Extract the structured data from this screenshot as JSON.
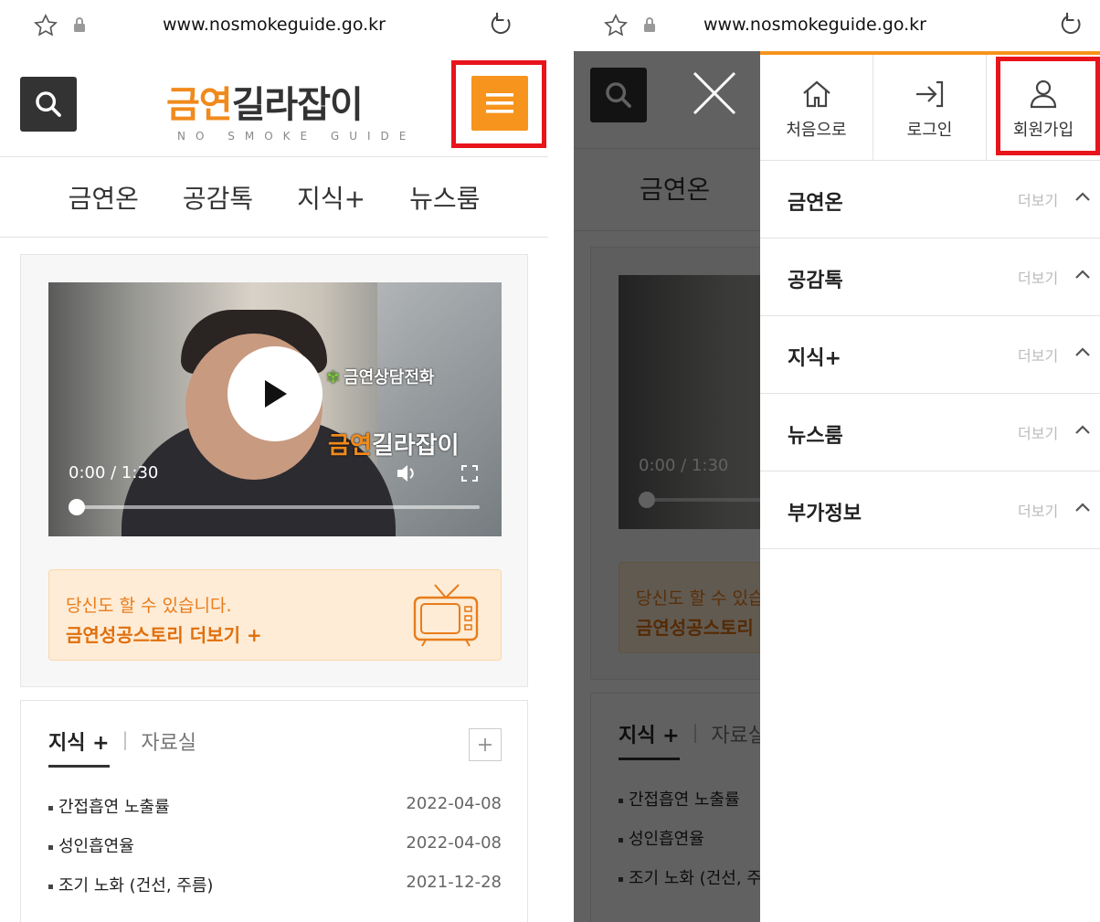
{
  "browser": {
    "url": "www.nosmokeguide.go.kr"
  },
  "logo": {
    "main_orange": "금연",
    "main_dark": "길라잡이",
    "sub": "NO SMOKE GUIDE"
  },
  "nav": [
    "금연온",
    "공감톡",
    "지식+",
    "뉴스룸"
  ],
  "video": {
    "brand_hotline": "금연상담전화",
    "brand_logo_orange": "금연",
    "brand_logo_dark": "길라잡이",
    "time": "0:00 / 1:30",
    "progress": 0.0
  },
  "story": {
    "line1": "당신도 할 수 있습니다.",
    "line2": "금연성공스토리 더보기 +"
  },
  "list": {
    "tab_active": "지식 +",
    "tab_sep": "|",
    "tab_inactive": "자료실",
    "items": [
      {
        "title": "간접흡연 노출률",
        "date": "2022-04-08"
      },
      {
        "title": "성인흡연율",
        "date": "2022-04-08"
      },
      {
        "title": "조기 노화 (건선, 주름)",
        "date": "2021-12-28"
      }
    ]
  },
  "drawer": {
    "quick": [
      {
        "label": "처음으로",
        "icon": "home-icon"
      },
      {
        "label": "로그인",
        "icon": "login-icon"
      },
      {
        "label": "회원가입",
        "icon": "user-icon"
      }
    ],
    "more_label": "더보기",
    "sections": [
      "금연온",
      "공감톡",
      "지식+",
      "뉴스룸",
      "부가정보"
    ]
  },
  "colors": {
    "accent": "#f7941d",
    "highlight": "#e8141c"
  }
}
